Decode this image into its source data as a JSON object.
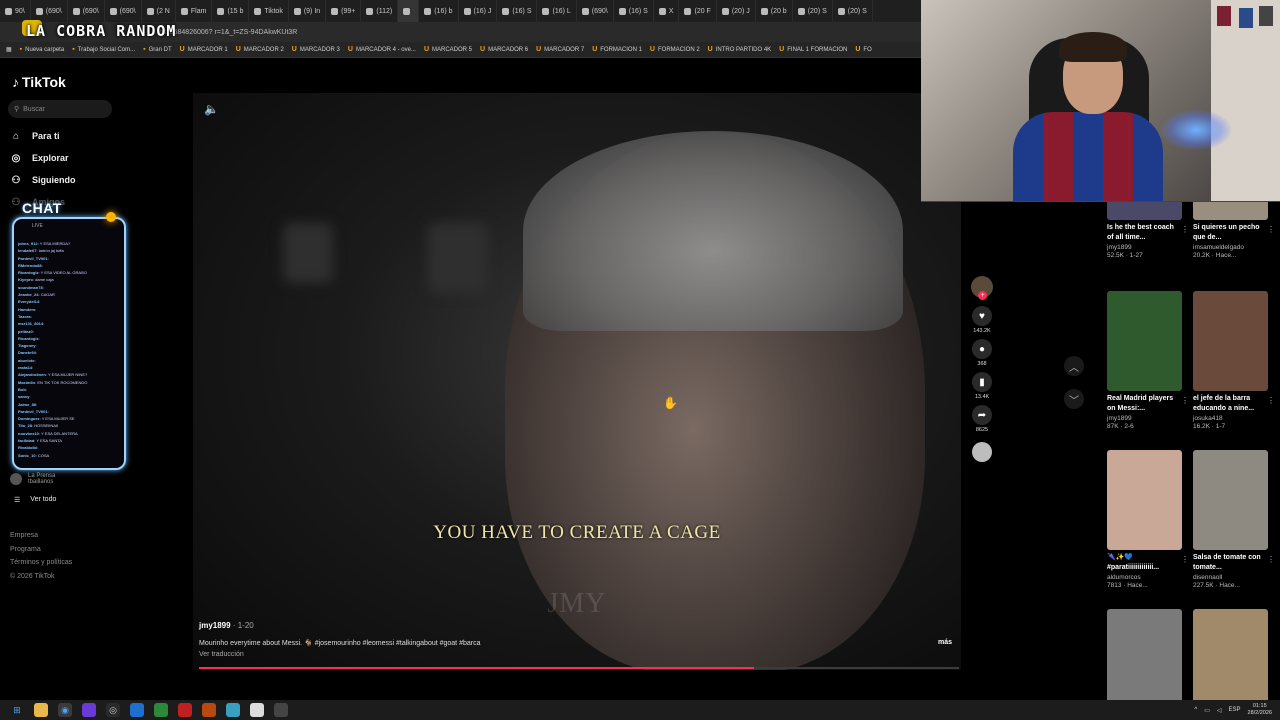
{
  "browser": {
    "stream_title": "LA COBRA RANDOM",
    "url": "t318584826006? r=1&_t=ZS-94DAkwKUt3R",
    "tabs": [
      "90\\",
      "(690\\",
      "(690\\",
      "(690\\",
      "(2 N",
      "Flam",
      "(15 b",
      "Tiktok",
      "(9) In",
      "(99+",
      "(112)",
      "",
      "(16) b",
      "(16) J",
      "(16) S",
      "(16) L",
      "(690\\",
      "(16) S",
      "X",
      "(20 F",
      "(20) J",
      "(20 b",
      "(20) S",
      "(20) S"
    ],
    "bookmarks": [
      {
        "label": "Nueva carpeta",
        "u": false
      },
      {
        "label": "Trabajo Social Com...",
        "u": false
      },
      {
        "label": "Gran DT",
        "u": false
      },
      {
        "label": "MARCADOR 1",
        "u": true
      },
      {
        "label": "MARCADOR 2",
        "u": true
      },
      {
        "label": "MARCADOR 3",
        "u": true
      },
      {
        "label": "MARCADOR 4 - ove...",
        "u": true
      },
      {
        "label": "MARCADOR 5",
        "u": true
      },
      {
        "label": "MARCADOR 6",
        "u": true
      },
      {
        "label": "MARCADOR 7",
        "u": true
      },
      {
        "label": "FORMACION 1",
        "u": true
      },
      {
        "label": "FORMACION 2",
        "u": true
      },
      {
        "label": "INTRO PARTIDO 4K",
        "u": true
      },
      {
        "label": "FINAL 1 FORMACION",
        "u": true
      },
      {
        "label": "FO",
        "u": true
      }
    ]
  },
  "sidebar": {
    "logo": "TikTok",
    "search_placeholder": "Buscar",
    "nav": [
      {
        "label": "Para ti",
        "icon": "home-icon"
      },
      {
        "label": "Explorar",
        "icon": "compass-icon"
      },
      {
        "label": "Siguiendo",
        "icon": "user-icon"
      },
      {
        "label": "Amigos",
        "icon": "users-icon"
      }
    ],
    "chat_title": "CHAT",
    "live_label": "LIVE",
    "chat_lines": [
      {
        "user": "johns_912",
        "text": "Y ESA MIERDA?"
      },
      {
        "user": "lendafe67",
        "text": "ladrón jaj tuffa"
      },
      {
        "user": "Pardevil_TV001",
        "text": ""
      },
      {
        "user": "RMelendo88",
        "text": ""
      },
      {
        "user": "Ricardoglz",
        "text": "Y ESA VIDEO AL GRABO"
      },
      {
        "user": "Kiyepro",
        "text": "dame caja"
      },
      {
        "user": "soundman78",
        "text": ""
      },
      {
        "user": "Jeanbe_24",
        "text": "CAGAR"
      },
      {
        "user": "Everydel14",
        "text": ""
      },
      {
        "user": "Hamdem",
        "text": ""
      },
      {
        "user": "Tazora",
        "text": ""
      },
      {
        "user": "msr101_8014",
        "text": ""
      },
      {
        "user": "pelitaz0",
        "text": ""
      },
      {
        "user": "Ricardoglz",
        "text": ""
      },
      {
        "user": "Tiagoney",
        "text": ""
      },
      {
        "user": "Danete94",
        "text": ""
      },
      {
        "user": "abuelote",
        "text": ""
      },
      {
        "user": "rasta14",
        "text": ""
      },
      {
        "user": "Alejandrolinen",
        "text": "Y ESA MUJER NINE?"
      },
      {
        "user": "Maximlin",
        "text": "EN TIK TOK ROCOMENDO"
      },
      {
        "user": "Bob",
        "text": ""
      },
      {
        "user": "sanxy",
        "text": ""
      },
      {
        "user": "Jaime_88",
        "text": ""
      },
      {
        "user": "Pardevil_TV001",
        "text": ""
      },
      {
        "user": "Dominguez",
        "text": "Y ESA MUJER SE"
      },
      {
        "user": "Tito_28",
        "text": "HOSSEIINAII"
      },
      {
        "user": "nouvbex10",
        "text": "Y ESA DELANTERA"
      },
      {
        "user": "facilidad",
        "text": "Y ESA SANTA"
      },
      {
        "user": "Rivaldolbi",
        "text": ""
      },
      {
        "user": "Sonic_10",
        "text": "COSA"
      }
    ],
    "following_label": "La Prensa",
    "following_user": "tbaillanos",
    "see_all": "Ver todo",
    "footer": [
      "Empresa",
      "Programa",
      "Términos y políticas",
      "© 2026 TikTok"
    ]
  },
  "video": {
    "caption": "YOU HAVE TO CREATE A CAGE",
    "watermark": "JMY",
    "author": "jmy1899",
    "date": "1-20",
    "description": "Mourinho everytime about Messi. 🐐 #josemourinho #leomessi #talkingabout #goat #barca",
    "translate": "Ver traducción",
    "more": "más",
    "progress": 0.73
  },
  "actions": [
    {
      "name": "like",
      "icon": "♥",
      "count": "143.2K"
    },
    {
      "name": "comment",
      "icon": "●",
      "count": "368"
    },
    {
      "name": "bookmark",
      "icon": "▮",
      "count": "13.4K"
    },
    {
      "name": "share",
      "icon": "➦",
      "count": "8625"
    }
  ],
  "recommended": [
    {
      "title": "Is he the best coach of all time...",
      "user": "jmy1899",
      "meta": "52.5K · 1-27",
      "thumb": "#4a4a68"
    },
    {
      "title": "Si quieres un pecho que de...",
      "user": "imsamueldelgado",
      "meta": "20.2K · Hace...",
      "thumb": "#9a8e7e"
    },
    {
      "title": "Real Madrid players on Messi:...",
      "user": "jmy1899",
      "meta": "87K · 2-6",
      "thumb": "#2f5a2e"
    },
    {
      "title": "el jefe de la barra educando a nine...",
      "user": "josuka418",
      "meta": "16.2K · 1-7",
      "thumb": "#6a4a3a"
    },
    {
      "title": "🌂✨💙 #paratiiiiiiiiiiiii...",
      "user": "aldumorcos",
      "meta": "7813 · Hace...",
      "thumb": "#c9a898"
    },
    {
      "title": "Salsa de tomate con tomate...",
      "user": "disennaoll",
      "meta": "227.5K · Hace...",
      "thumb": "#8e8a82"
    },
    {
      "title": "",
      "user": "",
      "meta": "",
      "thumb": "#7a7a7a"
    },
    {
      "title": "",
      "user": "",
      "meta": "",
      "thumb": "#a08a6a"
    }
  ],
  "taskbar": {
    "lang": "ESP",
    "time": "01:15",
    "date": "28/2/2026"
  }
}
